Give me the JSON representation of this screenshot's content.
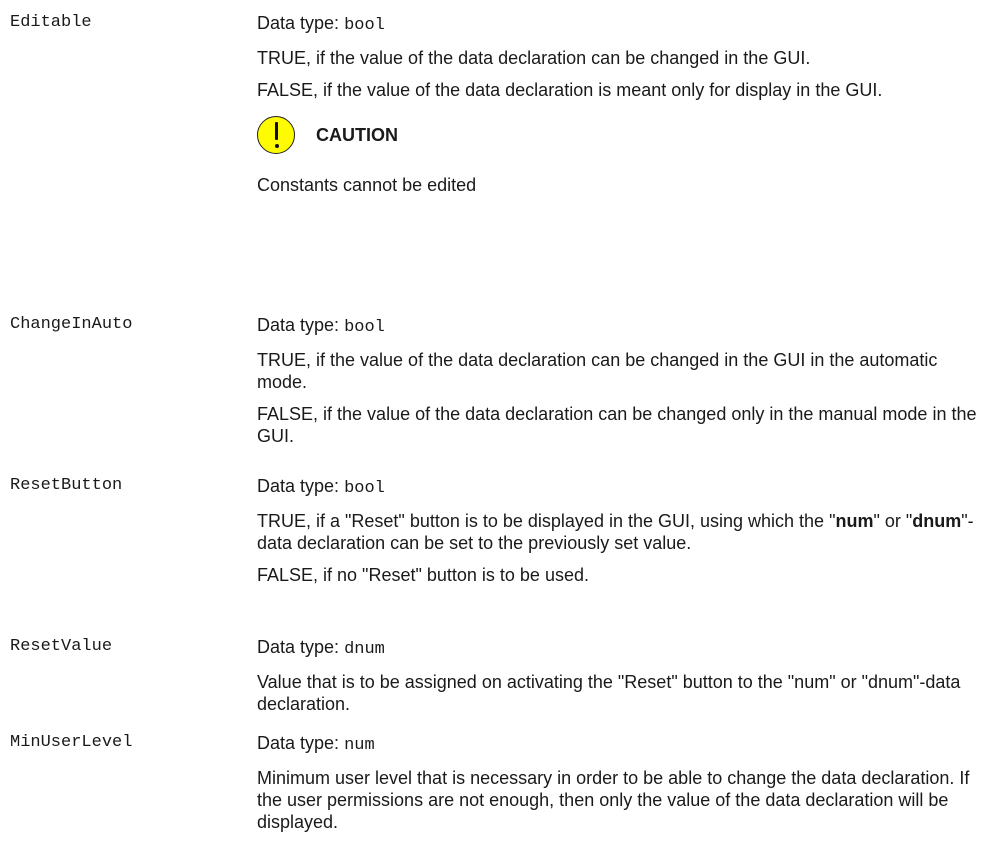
{
  "entries": [
    {
      "term": "Editable",
      "datatype_label": "Data type:",
      "datatype_value": "bool",
      "paras": [
        "TRUE, if the value of the data declaration can be changed in the GUI.",
        "FALSE, if the value of the data declaration is meant only for display in the GUI."
      ],
      "caution": {
        "icon": "caution-exclamation-icon",
        "title": "CAUTION",
        "text": "Constants cannot be edited"
      }
    },
    {
      "term": "ChangeInAuto",
      "datatype_label": "Data type:",
      "datatype_value": "bool",
      "paras": [
        "TRUE, if the value of the data declaration can be changed in the GUI in the automatic mode.",
        "FALSE, if the value of the data declaration can be changed only in the manual mode in the GUI."
      ]
    },
    {
      "term": "ResetButton",
      "datatype_label": "Data type:",
      "datatype_value": "bool",
      "paras": [
        {
          "pre": "TRUE, if a \"Reset\" button is to be displayed in the GUI, using which the \"",
          "bold1": "num",
          "mid": "\" or \"",
          "bold2": "dnum",
          "post": "\"-data declaration can be set to the previously set value."
        },
        "FALSE, if no \"Reset\" button is to be used."
      ]
    },
    {
      "term": "ResetValue",
      "datatype_label": "Data type:",
      "datatype_value": "dnum",
      "paras": [
        "Value that is to be assigned on activating the \"Reset\" button to the \"num\" or \"dnum\"-data declaration."
      ]
    },
    {
      "term": "MinUserLevel",
      "datatype_label": "Data type:",
      "datatype_value": "num",
      "paras": [
        "Minimum user level that is necessary in order to be able to change the data declaration. If the user permissions are not enough, then only the value of the data declaration will be displayed."
      ]
    }
  ],
  "colors": {
    "caution_icon_fill": "#fffb00",
    "text": "#1a1a1a"
  }
}
